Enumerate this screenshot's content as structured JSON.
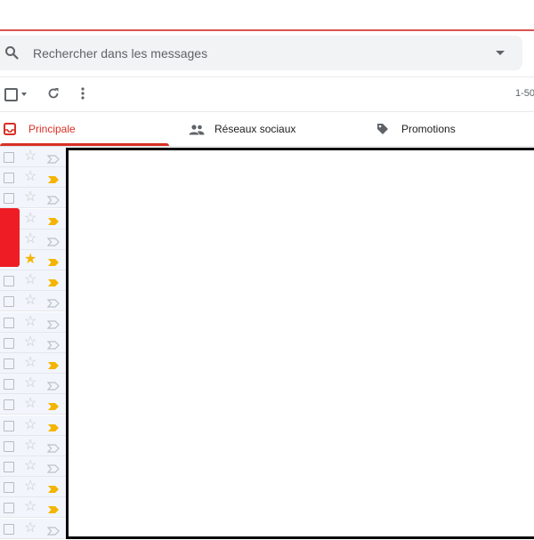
{
  "search": {
    "placeholder": "Rechercher dans les messages"
  },
  "toolbar": {
    "pagination": "1-50"
  },
  "tabs": [
    {
      "label": "Principale",
      "active": true,
      "icon": "inbox-icon"
    },
    {
      "label": "Réseaux sociaux",
      "active": false,
      "icon": "people-icon"
    },
    {
      "label": "Promotions",
      "active": false,
      "icon": "tag-icon"
    }
  ],
  "rows": [
    {
      "starred": false,
      "important": false
    },
    {
      "starred": false,
      "important": true
    },
    {
      "starred": false,
      "important": false
    },
    {
      "starred": false,
      "important": true
    },
    {
      "starred": false,
      "important": false
    },
    {
      "starred": true,
      "important": true
    },
    {
      "starred": false,
      "important": true
    },
    {
      "starred": false,
      "important": false
    },
    {
      "starred": false,
      "important": false
    },
    {
      "starred": false,
      "important": false
    },
    {
      "starred": false,
      "important": true
    },
    {
      "starred": false,
      "important": false
    },
    {
      "starred": false,
      "important": true
    },
    {
      "starred": false,
      "important": true
    },
    {
      "starred": false,
      "important": false
    },
    {
      "starred": false,
      "important": false
    },
    {
      "starred": false,
      "important": true
    },
    {
      "starred": false,
      "important": true
    },
    {
      "starred": false,
      "important": false
    }
  ],
  "colors": {
    "accent": "#d93025",
    "star": "#f4b400",
    "important": "#f4b400",
    "redaction": "#ee1c25"
  }
}
